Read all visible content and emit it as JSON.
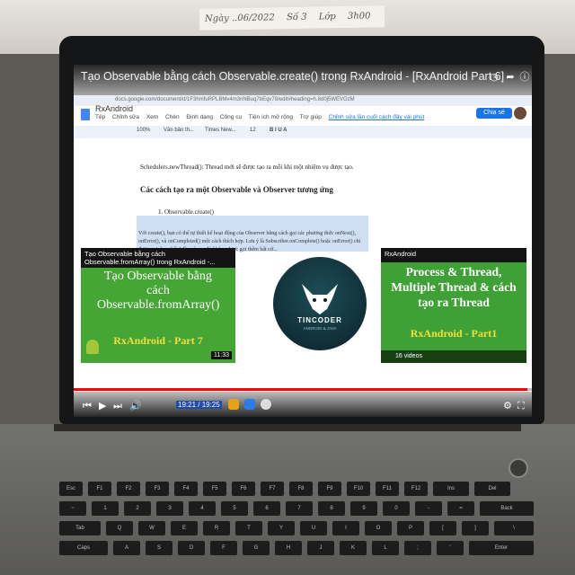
{
  "note": {
    "items": [
      "Ngày ..06/2022",
      "Số 3",
      "Lớp",
      "3h00"
    ]
  },
  "video": {
    "title": "Tạo Observable bằng cách Observable.create() trong RxAndroid - [RxAndroid Part 6]",
    "progress_fraction": 0.99,
    "time": "19:21 / 19:25"
  },
  "browser": {
    "url": "docs.google.com/document/d/1F3hmfuRPLBMv4m3nNBuq7bEqv79/edit#heading=h.8d0j5WEVGzM"
  },
  "docs": {
    "title": "RxAndroid",
    "menu": [
      "Tệp",
      "Chỉnh sửa",
      "Xem",
      "Chèn",
      "Định dạng",
      "Công cụ",
      "Tiện ích mở rộng",
      "Trợ giúp",
      "Chỉnh sửa lần cuối cách đây vài phút"
    ],
    "share_label": "Chia sẻ",
    "zoom": "100%",
    "style": "Văn bản th...",
    "font": "Times New...",
    "font_size": "12",
    "line1": "Schedulers.newThread(): Thread mới sẽ được tạo ra mỗi khi một nhiệm vụ được tạo.",
    "heading": "Các cách tạo ra một Observable và Observer tương ứng",
    "list_item": "1.    Observable.create()",
    "para": "Với create(), bạn có thể tự thiết kế hoạt động của Observer bằng cách gọi các phương thức onNext(), onError(), và onCompleted() một cách thích hợp. Lưu ý là Subscriber.onComplete() hoặc onError() chỉ được gọi duy nhất 1 lần và sau đó không được gọi thêm bất cứ..."
  },
  "endscreen": {
    "left": {
      "header": "Tạo Observable bằng cách Observable.fromArray() trong RxAndroid -...",
      "big_text": "Tạo Observable bằng cách Observable.fromArray()",
      "sub_text": "RxAndroid - Part 7",
      "duration": "11:33"
    },
    "center": {
      "name": "TINCODER",
      "tagline": "ANDROID & JAVA"
    },
    "right": {
      "header": "RxAndroid",
      "big_text": "Process & Thread, Multiple Thread & cách tạo ra Thread",
      "sub_text": "RxAndroid - Part1",
      "playlist": "16 videos"
    }
  },
  "colors": {
    "youtube_red": "#ff0000",
    "docs_blue": "#1a73e8",
    "card_green": "#45a535",
    "card_yellow": "#f3df3a"
  }
}
